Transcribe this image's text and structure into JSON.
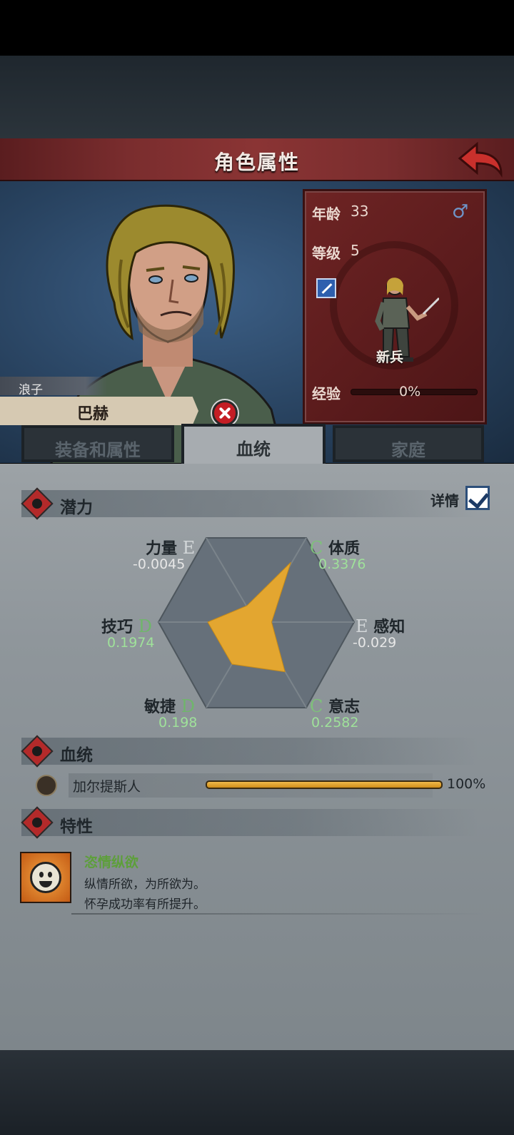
{
  "header": {
    "title": "角色属性"
  },
  "character": {
    "role": "浪子",
    "name": "巴赫",
    "age_label": "年龄",
    "age": "33",
    "level_label": "等级",
    "level": "5",
    "rank": "新兵",
    "xp_label": "经验",
    "xp_percent": "0%",
    "xp_fraction": 0
  },
  "tabs": [
    {
      "label": "装备和属性",
      "active": false
    },
    {
      "label": "血统",
      "active": true
    },
    {
      "label": "家庭",
      "active": false
    }
  ],
  "potential": {
    "title": "潜力",
    "detail_label": "详情",
    "detail_checked": true,
    "attributes": {
      "strength": {
        "name": "力量",
        "grade": "E",
        "value": "-0.0045"
      },
      "constitution": {
        "name": "体质",
        "grade": "C",
        "value": "0.3376"
      },
      "skill": {
        "name": "技巧",
        "grade": "D",
        "value": "0.1974"
      },
      "perception": {
        "name": "感知",
        "grade": "E",
        "value": "-0.029"
      },
      "agility": {
        "name": "敏捷",
        "grade": "D",
        "value": "0.198"
      },
      "will": {
        "name": "意志",
        "grade": "C",
        "value": "0.2582"
      }
    }
  },
  "bloodline": {
    "title": "血统",
    "items": [
      {
        "name": "加尔提斯人",
        "percent": "100%",
        "fraction": 1.0
      }
    ]
  },
  "traits": {
    "title": "特性",
    "items": [
      {
        "name": "恣情纵欲",
        "desc_line1": "纵情所欲，为所欲为。",
        "desc_line2": "怀孕成功率有所提升。"
      }
    ]
  },
  "colors": {
    "accent_red": "#7a2d2e",
    "bloodline_bar": "#e3a630",
    "grade_good": "#7ec07a"
  }
}
